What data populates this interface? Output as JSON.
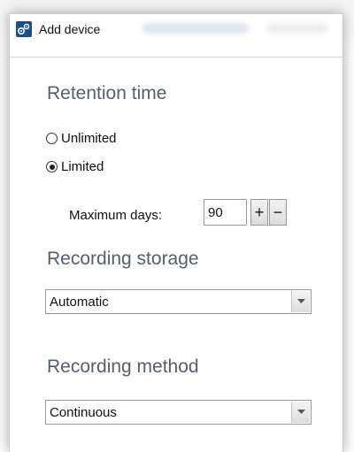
{
  "window": {
    "title": "Add device",
    "icon": "device-settings-icon"
  },
  "retention": {
    "heading": "Retention time",
    "options": [
      {
        "label": "Unlimited",
        "checked": false
      },
      {
        "label": "Limited",
        "checked": true
      }
    ],
    "max_days_label": "Maximum days:",
    "max_days_value": "90",
    "increment_label": "+",
    "decrement_label": "−"
  },
  "storage": {
    "heading": "Recording storage",
    "selected": "Automatic"
  },
  "method": {
    "heading": "Recording method",
    "selected": "Continuous"
  },
  "colors": {
    "heading": "#53606e",
    "app_icon_bg": "#1a4f8a"
  }
}
